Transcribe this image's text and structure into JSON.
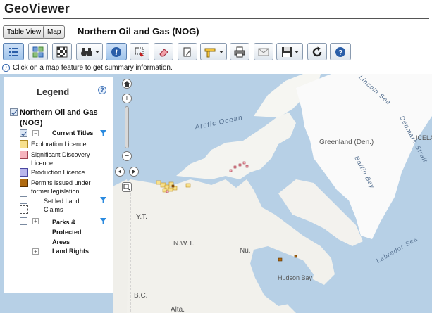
{
  "app": {
    "title": "GeoViewer"
  },
  "header": {
    "table_view_label": "Table View",
    "map_label": "Map",
    "page_title": "Northern Oil and Gas (NOG)"
  },
  "toolbar": {
    "buttons": [
      "legend-icon",
      "basemap-icon",
      "overview-icon",
      "binoculars-icon",
      "info-icon",
      "select-icon",
      "eraser-icon",
      "draw-icon",
      "measure-icon",
      "print-icon",
      "email-icon",
      "save-icon",
      "refresh-icon",
      "help-icon"
    ]
  },
  "info_bar": {
    "message": "Click on a map feature to get summary information."
  },
  "legend": {
    "title": "Legend",
    "help": "?",
    "layer_group": "Northern Oil and Gas (NOG)",
    "current_titles": "Current Titles",
    "items": [
      {
        "label": "Exploration Licence",
        "color": "#f7e08c"
      },
      {
        "label": "Significant Discovery Licence",
        "color": "#f6b3bd"
      },
      {
        "label": "Production Licence",
        "color": "#b9b6ec"
      },
      {
        "label": "Permits issued under former legislation",
        "color": "#b06a10"
      }
    ],
    "settled_land_claims": "Settled Land Claims",
    "parks": "Parks & Protected Areas",
    "land_rights": "Land Rights"
  },
  "map": {
    "labels": {
      "arctic_ocean": "Arctic Ocean",
      "greenland": "Greenland (Den.)",
      "baffin_bay": "Baffin Bay",
      "labrador_sea": "Labrador Sea",
      "lincoln_sea": "Lincoln Sea",
      "denmark_strait": "Denmark Strait",
      "icela": "ICELA",
      "yt": "Y.T.",
      "nwt": "N.W.T.",
      "nu": "Nu.",
      "bc": "B.C.",
      "alta": "Alta.",
      "hudson_bay": "Hudson Bay"
    },
    "colors": {
      "water": "#b7d0e6",
      "land": "#f2f1ec",
      "ice": "#fafafa"
    }
  }
}
